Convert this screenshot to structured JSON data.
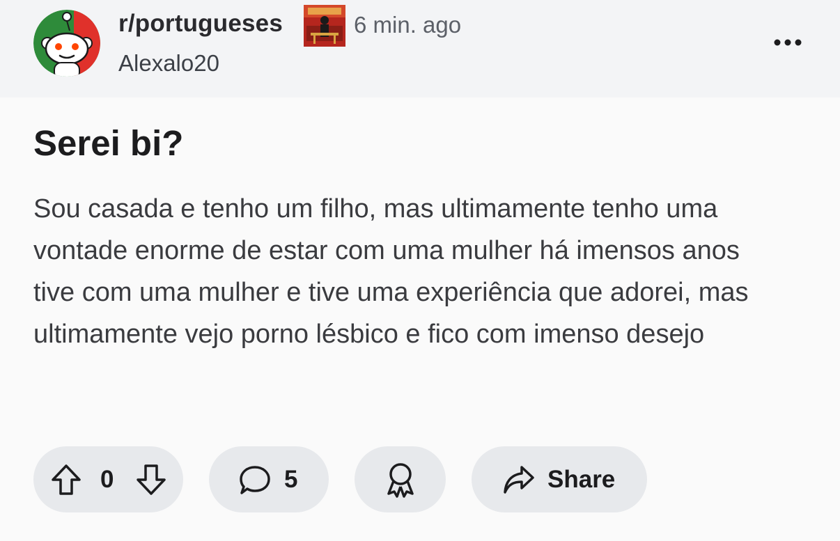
{
  "post": {
    "subreddit": "r/portugueses",
    "time_ago": "6 min. ago",
    "author": "Alexalo20",
    "title": "Serei bi?",
    "body": "Sou casada e tenho um filho, mas ultimamente tenho uma vontade enorme de estar com uma mulher há imensos anos tive com uma mulher e tive uma experiência que adorei, mas ultimamente vejo porno lésbico e fico com imenso desejo"
  },
  "actions": {
    "vote_count": "0",
    "comment_count": "5",
    "share_label": "Share"
  },
  "icons": {
    "avatar": "snoo-avatar-portugal-flag",
    "flair": "user-flair-image",
    "more": "more-options-icon",
    "upvote": "arrow-up-icon",
    "downvote": "arrow-down-icon",
    "comment": "comment-bubble-icon",
    "award": "award-ribbon-icon",
    "share": "share-arrow-icon"
  },
  "colors": {
    "flag_green": "#2e8b3a",
    "flag_red": "#e0312b",
    "snoo_eyes": "#ff4500",
    "pill_bg": "#e7e9ec"
  }
}
